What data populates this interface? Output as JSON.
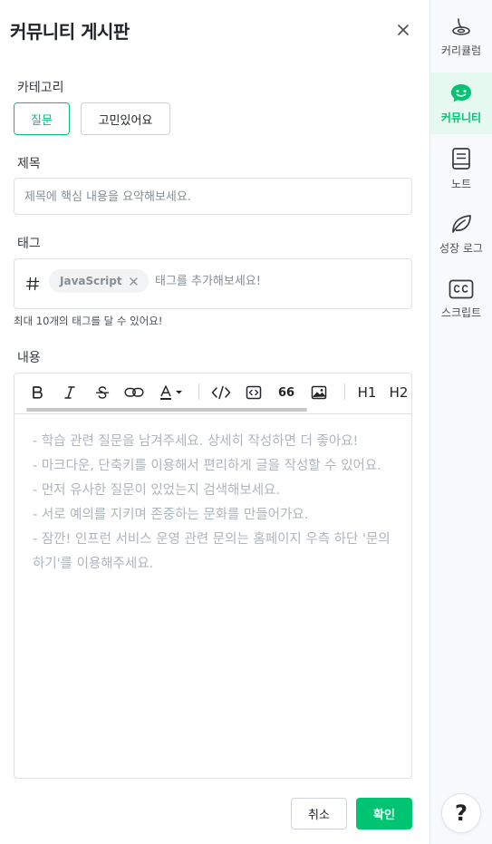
{
  "header": {
    "title": "커뮤니티 게시판"
  },
  "category": {
    "label": "카테고리",
    "options": [
      {
        "label": "질문",
        "active": true
      },
      {
        "label": "고민있어요",
        "active": false
      }
    ]
  },
  "subject": {
    "label": "제목",
    "placeholder": "제목에 핵심 내용을 요약해보세요."
  },
  "tags": {
    "label": "태그",
    "chips": [
      "JavaScript"
    ],
    "placeholder": "태그를 추가해보세요!",
    "hint": "최대 10개의 태그를 달 수 있어요!"
  },
  "content": {
    "label": "내용",
    "toolbar": {
      "h1_label": "H1",
      "h2_label": "H2",
      "quote_label": "66"
    },
    "guides": [
      "- 학습 관련 질문을 남겨주세요. 상세히 작성하면 더 좋아요!",
      "- 마크다운, 단축키를 이용해서 편리하게 글을 작성할 수 있어요.",
      "- 먼저 유사한 질문이 있었는지 검색해보세요.",
      "- 서로 예의를 지키며 존중하는 문화를 만들어가요.",
      "- 잠깐! 인프런 서비스 운영 관련 문의는 홈페이지 우측 하단 '문의하기'를 이용해주세요."
    ]
  },
  "actions": {
    "cancel_label": "취소",
    "confirm_label": "확인"
  },
  "rail": {
    "items": [
      {
        "label": "커리큘럼",
        "icon": "curriculum-icon",
        "active": false
      },
      {
        "label": "커뮤니티",
        "icon": "community-icon",
        "active": true
      },
      {
        "label": "노트",
        "icon": "note-icon",
        "active": false
      },
      {
        "label": "성장 로그",
        "icon": "growth-log-icon",
        "active": false
      },
      {
        "label": "스크립트",
        "icon": "script-icon",
        "active": false
      }
    ],
    "help_label": "?"
  },
  "colors": {
    "accent": "#00c471",
    "border": "#dee2e6",
    "placeholder": "#adb5bd"
  }
}
